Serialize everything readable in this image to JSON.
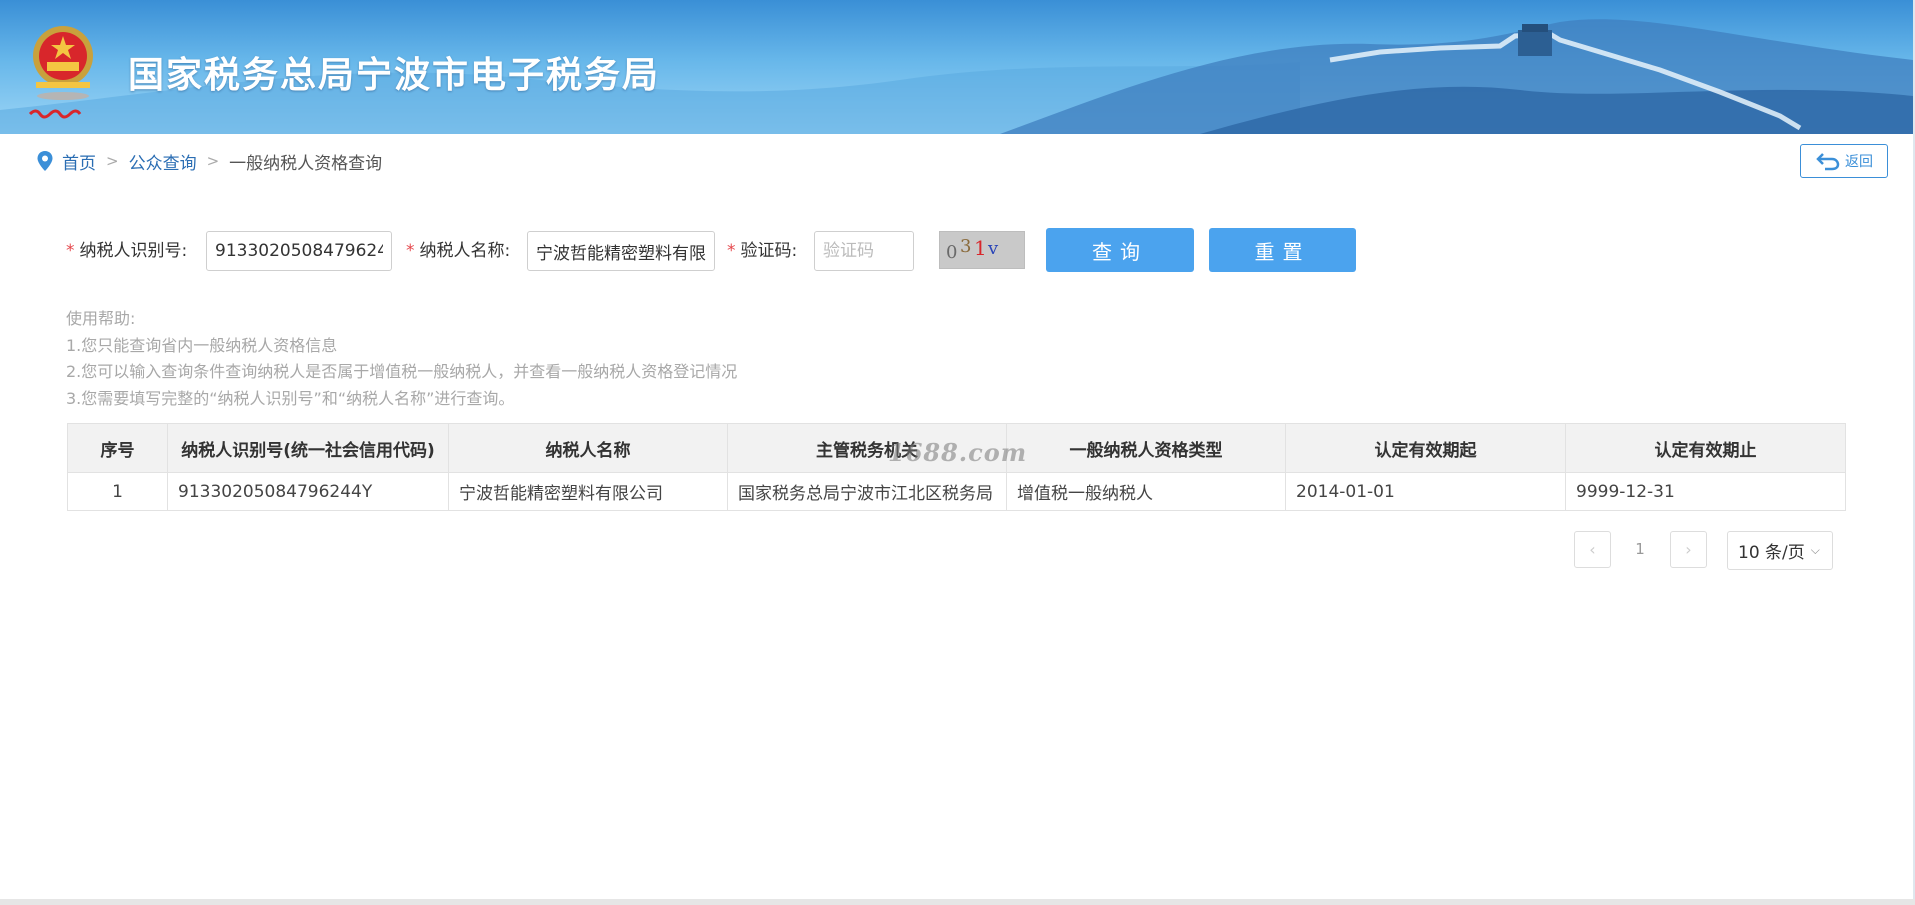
{
  "header": {
    "site_title": "国家税务总局宁波市电子税务局",
    "emblem_caption": "中国税务"
  },
  "breadcrumb": {
    "home": "首页",
    "separator": ">",
    "public_query": "公众查询",
    "current": "一般纳税人资格查询"
  },
  "back_button": {
    "label": "返回",
    "icon": "return-arrow-icon"
  },
  "form": {
    "required_mark": "*",
    "taxpayer_id_label": "纳税人识别号:",
    "taxpayer_id_value": "91330205084796244Y",
    "taxpayer_name_label": "纳税人名称:",
    "taxpayer_name_value": "宁波哲能精密塑料有限公司",
    "captcha_label": "验证码:",
    "captcha_placeholder": "验证码",
    "captcha_text": "031v",
    "query_button": "查询",
    "reset_button": "重置"
  },
  "help": {
    "title": "使用帮助:",
    "lines": [
      "1.您只能查询省内一般纳税人资格信息",
      "2.您可以输入查询条件查询纳税人是否属于增值税一般纳税人，并查看一般纳税人资格登记情况",
      "3.您需要填写完整的“纳税人识别号”和“纳税人名称”进行查询。"
    ]
  },
  "table": {
    "columns": [
      "序号",
      "纳税人识别号(统一社会信用代码)",
      "纳税人名称",
      "主管税务机关",
      "一般纳税人资格类型",
      "认定有效期起",
      "认定有效期止"
    ],
    "rows": [
      [
        "1",
        "91330205084796244Y",
        "宁波哲能精密塑料有限公司",
        "国家税务总局宁波市江北区税务局",
        "增值税一般纳税人",
        "2014-01-01",
        "9999-12-31"
      ]
    ]
  },
  "watermark": "1688.com",
  "pagination": {
    "prev": "‹",
    "page": "1",
    "next": "›",
    "page_size": "10 条/页",
    "caret": "⌵"
  },
  "colors": {
    "primary_button": "#4ba3ee",
    "link": "#2a6db3",
    "required": "#e5484d",
    "header_blue": "#3a8fd6"
  }
}
